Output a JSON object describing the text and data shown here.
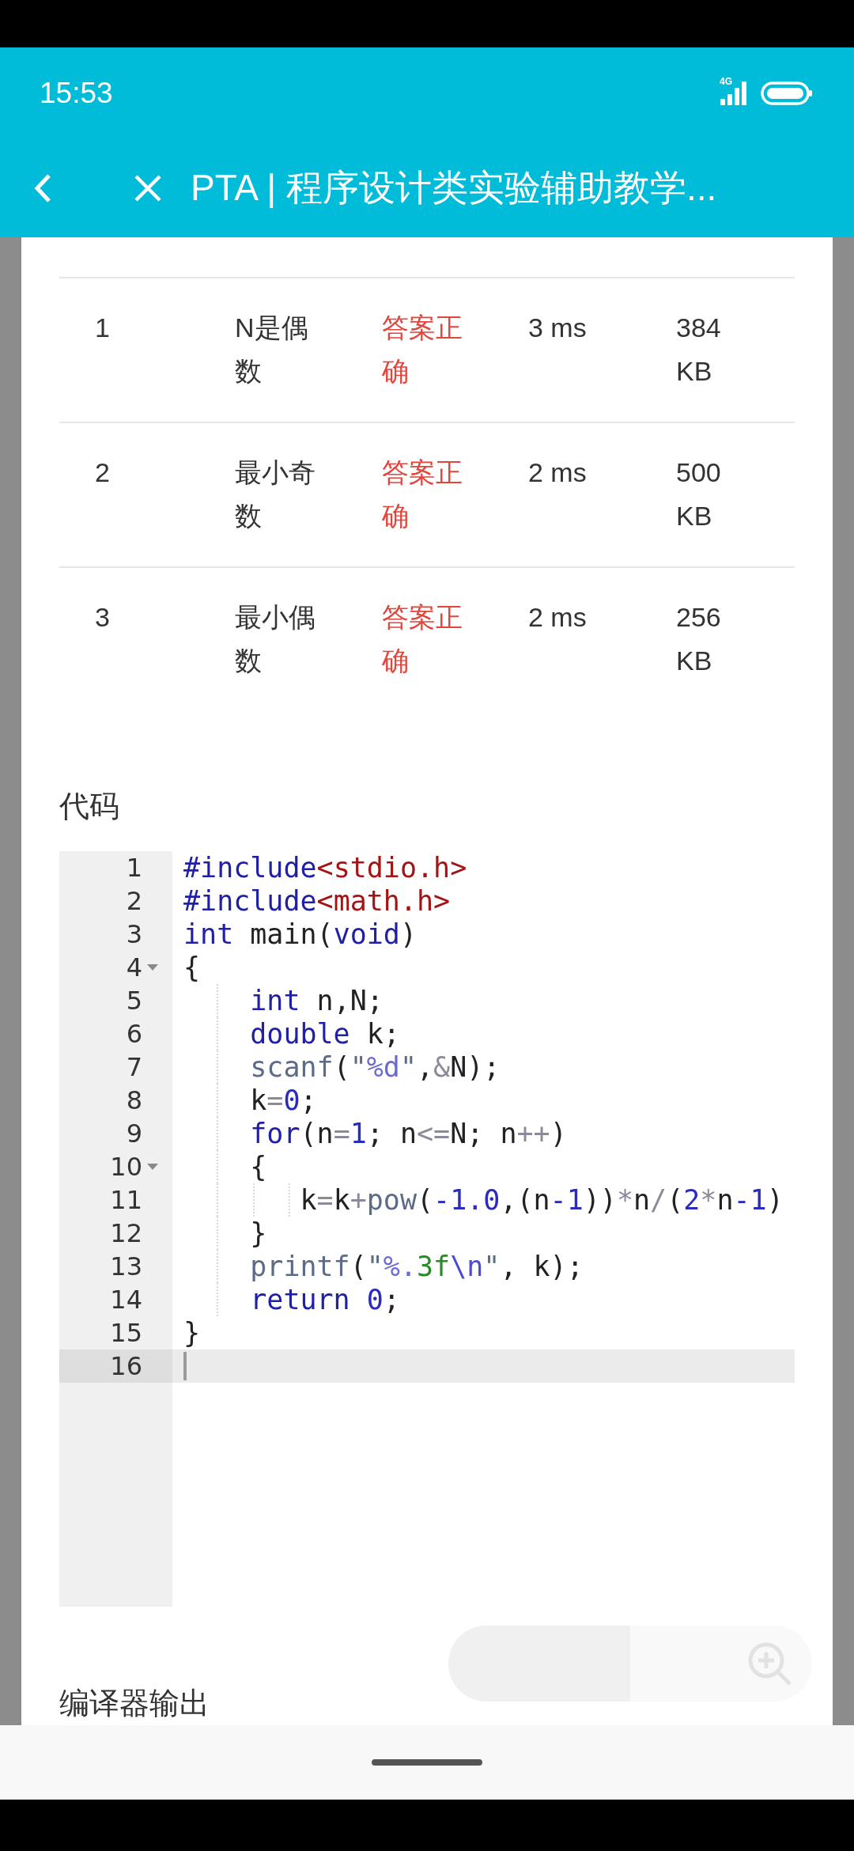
{
  "status_bar": {
    "time": "15:53",
    "network": "4G"
  },
  "title_bar": {
    "title": "PTA | 程序设计类实验辅助教学..."
  },
  "results_table": {
    "rows": [
      {
        "cells": [
          "1",
          "N是偶数",
          "答案正确",
          "3 ms",
          "384 KB"
        ]
      },
      {
        "cells": [
          "2",
          "最小奇数",
          "答案正确",
          "2 ms",
          "500 KB"
        ]
      },
      {
        "cells": [
          "3",
          "最小偶数",
          "答案正确",
          "2 ms",
          "256 KB"
        ]
      }
    ]
  },
  "code_section": {
    "heading": "代码",
    "lines": [
      {
        "number": "1",
        "fold": false,
        "active": false,
        "tokens": [
          {
            "text": "#include",
            "kind": "keyword"
          },
          {
            "text": "<stdio.h>",
            "kind": "header"
          }
        ]
      },
      {
        "number": "2",
        "fold": false,
        "active": false,
        "tokens": [
          {
            "text": "#include",
            "kind": "keyword"
          },
          {
            "text": "<math.h>",
            "kind": "header"
          }
        ]
      },
      {
        "number": "3",
        "fold": false,
        "active": false,
        "tokens": [
          {
            "text": "int",
            "kind": "keyword"
          },
          {
            "text": " main(",
            "kind": "plain"
          },
          {
            "text": "void",
            "kind": "keyword"
          },
          {
            "text": ")",
            "kind": "plain"
          }
        ]
      },
      {
        "number": "4",
        "fold": true,
        "active": false,
        "tokens": [
          {
            "text": "{",
            "kind": "plain"
          }
        ],
        "children": [
          {
            "number": "5",
            "fold": false,
            "active": false,
            "tokens": [
              {
                "text": "int",
                "kind": "keyword"
              },
              {
                "text": " n,N;",
                "kind": "plain"
              }
            ]
          },
          {
            "number": "6",
            "fold": false,
            "active": false,
            "tokens": [
              {
                "text": "double",
                "kind": "keyword"
              },
              {
                "text": " k;",
                "kind": "plain"
              }
            ]
          },
          {
            "number": "7",
            "fold": false,
            "active": false,
            "tokens": [
              {
                "text": "scanf",
                "kind": "func"
              },
              {
                "text": "(",
                "kind": "plain"
              },
              {
                "text": "\"",
                "kind": "string"
              },
              {
                "text": "%d",
                "kind": "format"
              },
              {
                "text": "\"",
                "kind": "string"
              },
              {
                "text": ",",
                "kind": "plain"
              },
              {
                "text": "&",
                "kind": "op"
              },
              {
                "text": "N);",
                "kind": "plain"
              }
            ]
          },
          {
            "number": "8",
            "fold": false,
            "active": false,
            "tokens": [
              {
                "text": "k",
                "kind": "plain"
              },
              {
                "text": "=",
                "kind": "op"
              },
              {
                "text": "0",
                "kind": "number"
              },
              {
                "text": ";",
                "kind": "plain"
              }
            ]
          },
          {
            "number": "9",
            "fold": false,
            "active": false,
            "tokens": [
              {
                "text": "for",
                "kind": "keyword"
              },
              {
                "text": "(n",
                "kind": "plain"
              },
              {
                "text": "=",
                "kind": "op"
              },
              {
                "text": "1",
                "kind": "number"
              },
              {
                "text": "; n",
                "kind": "plain"
              },
              {
                "text": "<=",
                "kind": "op"
              },
              {
                "text": "N; n",
                "kind": "plain"
              },
              {
                "text": "++",
                "kind": "op"
              },
              {
                "text": ")",
                "kind": "plain"
              }
            ]
          },
          {
            "number": "10",
            "fold": true,
            "active": false,
            "tokens": [
              {
                "text": "{",
                "kind": "plain"
              }
            ],
            "children": [
              {
                "number": "11",
                "fold": false,
                "active": false,
                "tokens": [
                  {
                    "text": "k",
                    "kind": "plain"
                  },
                  {
                    "text": "=",
                    "kind": "op"
                  },
                  {
                    "text": "k",
                    "kind": "plain"
                  },
                  {
                    "text": "+",
                    "kind": "op"
                  },
                  {
                    "text": "pow",
                    "kind": "func"
                  },
                  {
                    "text": "(",
                    "kind": "plain"
                  },
                  {
                    "text": "-1.0",
                    "kind": "number"
                  },
                  {
                    "text": ",(n",
                    "kind": "plain"
                  },
                  {
                    "text": "-1",
                    "kind": "number"
                  },
                  {
                    "text": "))",
                    "kind": "plain"
                  },
                  {
                    "text": "*",
                    "kind": "op"
                  },
                  {
                    "text": "n",
                    "kind": "plain"
                  },
                  {
                    "text": "/",
                    "kind": "op"
                  },
                  {
                    "text": "(",
                    "kind": "plain"
                  },
                  {
                    "text": "2",
                    "kind": "number"
                  },
                  {
                    "text": "*",
                    "kind": "op"
                  },
                  {
                    "text": "n",
                    "kind": "plain"
                  },
                  {
                    "text": "-1",
                    "kind": "number"
                  },
                  {
                    "text": ")",
                    "kind": "plain"
                  }
                ]
              }
            ]
          },
          {
            "number": "12",
            "fold": false,
            "active": false,
            "tokens": [
              {
                "text": "}",
                "kind": "plain"
              }
            ]
          },
          {
            "number": "13",
            "fold": false,
            "active": false,
            "tokens": [
              {
                "text": "printf",
                "kind": "func"
              },
              {
                "text": "(",
                "kind": "plain"
              },
              {
                "text": "\"",
                "kind": "string"
              },
              {
                "text": "%.",
                "kind": "format"
              },
              {
                "text": "3f",
                "kind": "literal"
              },
              {
                "text": "\\n",
                "kind": "escape"
              },
              {
                "text": "\"",
                "kind": "string"
              },
              {
                "text": ", k);",
                "kind": "plain"
              }
            ]
          },
          {
            "number": "14",
            "fold": false,
            "active": false,
            "tokens": [
              {
                "text": "return",
                "kind": "keyword"
              },
              {
                "text": " 0",
                "kind": "number"
              },
              {
                "text": ";",
                "kind": "plain"
              }
            ]
          }
        ]
      },
      {
        "number": "15",
        "fold": false,
        "active": false,
        "tokens": [
          {
            "text": "}",
            "kind": "plain"
          }
        ]
      },
      {
        "number": "16",
        "fold": false,
        "active": true
      }
    ]
  },
  "compiler_section": {
    "heading": "编译器输出"
  }
}
